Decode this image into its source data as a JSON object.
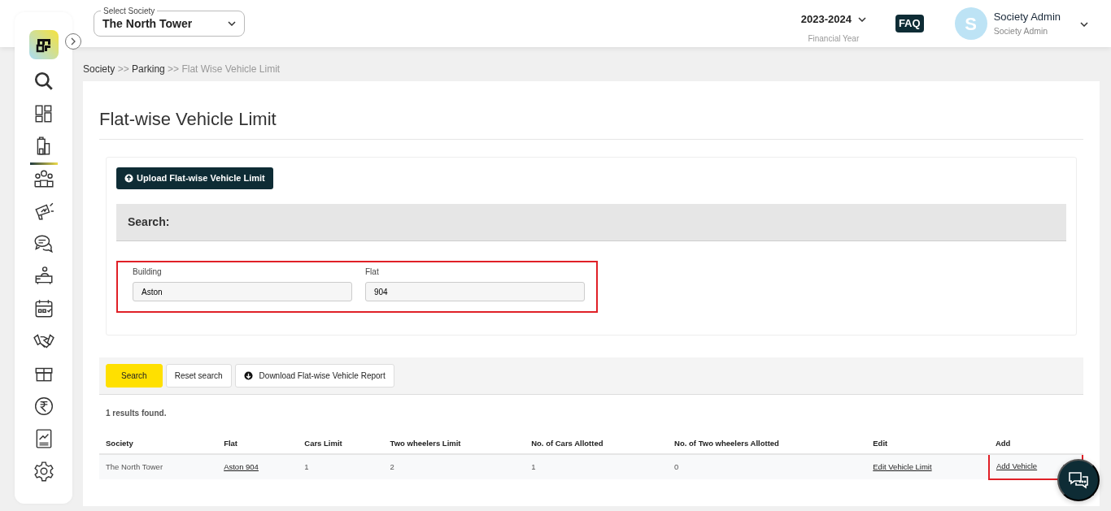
{
  "header": {
    "society_label": "Select Society",
    "society": "The North Tower",
    "year": "2023-2024",
    "year_caption": "Financial Year",
    "faq": "FAQ",
    "avatar_letter": "S",
    "user_name": "Society Admin",
    "user_role": "Society Admin"
  },
  "sidebar": {
    "items": [
      {
        "kind": "search",
        "selected": false
      },
      {
        "kind": "dashboard",
        "selected": false
      },
      {
        "kind": "building",
        "selected": true
      },
      {
        "kind": "people",
        "selected": false
      },
      {
        "kind": "megaphone",
        "selected": false
      },
      {
        "kind": "chat",
        "selected": false
      },
      {
        "kind": "desk",
        "selected": false
      },
      {
        "kind": "calendar",
        "selected": false
      },
      {
        "kind": "handshake",
        "selected": false
      },
      {
        "kind": "box",
        "selected": false
      },
      {
        "kind": "rupee",
        "selected": false
      },
      {
        "kind": "report",
        "selected": false
      },
      {
        "kind": "settings",
        "selected": false
      }
    ]
  },
  "breadcrumb": [
    {
      "label": "Society",
      "link": true
    },
    {
      "label": "Parking",
      "link": true
    },
    {
      "label": "Flat Wise Vehicle Limit",
      "link": false
    }
  ],
  "breadcrumb_separator": ">>",
  "page_title": "Flat-wise Vehicle Limit",
  "upload_button": "Upload Flat-wise Vehicle Limit",
  "search_panel": {
    "title": "Search:",
    "highlighted": true,
    "fields": [
      {
        "label": "Building",
        "value": "Aston"
      },
      {
        "label": "Flat",
        "value": "904"
      }
    ]
  },
  "actions": [
    "Search",
    "Reset search",
    "Download Flat-wise Vehicle Report"
  ],
  "results_count": "1 results found.",
  "table": {
    "columns": [
      "Society",
      "Flat",
      "Cars Limit",
      "Two wheelers Limit",
      "No. of Cars Allotted",
      "No. of Two wheelers Allotted",
      "Edit",
      "Add"
    ],
    "rows": [
      {
        "cells": [
          {
            "text": "The North Tower",
            "link": false,
            "highlighted": false
          },
          {
            "text": "Aston 904",
            "link": true,
            "highlighted": false
          },
          {
            "text": "1",
            "link": false,
            "highlighted": false
          },
          {
            "text": "2",
            "link": false,
            "highlighted": false
          },
          {
            "text": "1",
            "link": false,
            "highlighted": false
          },
          {
            "text": "0",
            "link": false,
            "highlighted": false
          },
          {
            "text": "Edit Vehicle Limit",
            "link": true,
            "highlighted": false
          },
          {
            "text": "Add Vehicle",
            "link": true,
            "highlighted": true
          }
        ]
      }
    ]
  }
}
